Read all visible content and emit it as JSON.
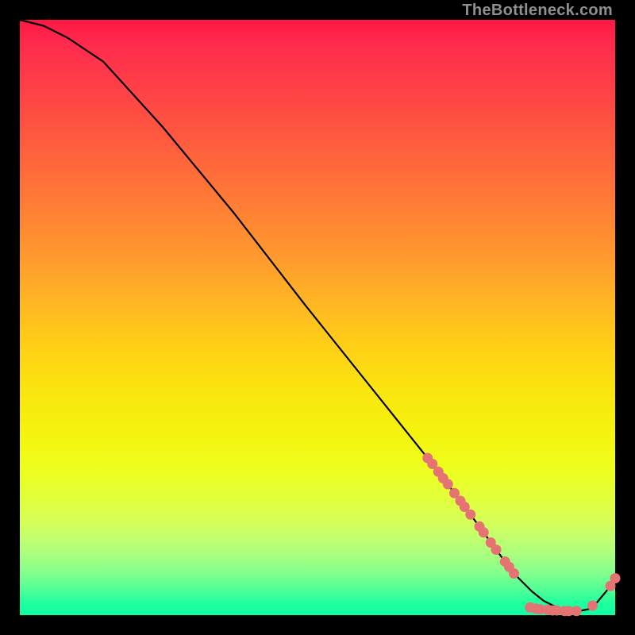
{
  "watermark": "TheBottleneck.com",
  "chart_data": {
    "type": "line",
    "title": "",
    "xlabel": "",
    "ylabel": "",
    "xlim": [
      0,
      100
    ],
    "ylim": [
      0,
      100
    ],
    "grid": false,
    "legend": false,
    "series": [
      {
        "name": "curve",
        "x": [
          0,
          4,
          8,
          14,
          24,
          36,
          48,
          60,
          70,
          76,
          80,
          83,
          86,
          88,
          90,
          92,
          94,
          95.5,
          97,
          98.5,
          100
        ],
        "values": [
          100,
          99,
          97,
          93,
          82,
          67.5,
          52,
          37,
          24.5,
          16.5,
          11,
          7,
          4,
          2.4,
          1.4,
          0.9,
          0.7,
          1.0,
          2.2,
          4.0,
          6.2
        ]
      }
    ],
    "markers": [
      {
        "x": 68.5,
        "y": 26.4
      },
      {
        "x": 69.3,
        "y": 25.4
      },
      {
        "x": 70.3,
        "y": 24.1
      },
      {
        "x": 71.1,
        "y": 23.0
      },
      {
        "x": 71.9,
        "y": 22.0
      },
      {
        "x": 73.0,
        "y": 20.5
      },
      {
        "x": 74.0,
        "y": 19.2
      },
      {
        "x": 74.7,
        "y": 18.2
      },
      {
        "x": 75.7,
        "y": 16.9
      },
      {
        "x": 77.2,
        "y": 14.9
      },
      {
        "x": 77.9,
        "y": 13.9
      },
      {
        "x": 79.1,
        "y": 12.2
      },
      {
        "x": 80.0,
        "y": 11.0
      },
      {
        "x": 81.5,
        "y": 9.0
      },
      {
        "x": 82.2,
        "y": 8.1
      },
      {
        "x": 83.0,
        "y": 7.0
      },
      {
        "x": 85.7,
        "y": 1.3
      },
      {
        "x": 86.7,
        "y": 1.1
      },
      {
        "x": 87.4,
        "y": 1.0
      },
      {
        "x": 88.7,
        "y": 0.9
      },
      {
        "x": 89.5,
        "y": 0.8
      },
      {
        "x": 90.2,
        "y": 0.8
      },
      {
        "x": 91.5,
        "y": 0.7
      },
      {
        "x": 92.2,
        "y": 0.7
      },
      {
        "x": 93.5,
        "y": 0.7
      },
      {
        "x": 96.2,
        "y": 1.6
      },
      {
        "x": 99.2,
        "y": 4.9
      },
      {
        "x": 100.0,
        "y": 6.2
      }
    ],
    "marker_color": "#e57373",
    "curve_color": "#000000"
  }
}
